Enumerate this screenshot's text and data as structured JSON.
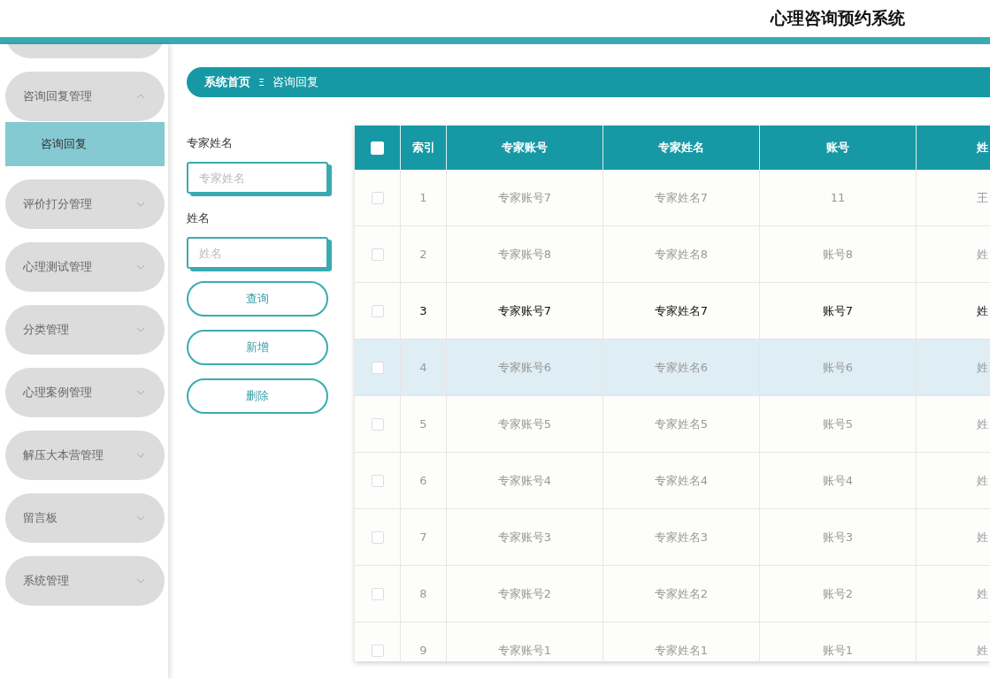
{
  "header": {
    "title": "心理咨询预约系统"
  },
  "sidebar": {
    "items": [
      {
        "label": "咨询回复管理",
        "expanded": true,
        "children": [
          {
            "label": "咨询回复",
            "selected": true
          }
        ]
      },
      {
        "label": "评价打分管理",
        "expanded": false
      },
      {
        "label": "心理测试管理",
        "expanded": false
      },
      {
        "label": "分类管理",
        "expanded": false
      },
      {
        "label": "心理案例管理",
        "expanded": false
      },
      {
        "label": "解压大本营管理",
        "expanded": false
      },
      {
        "label": "留言板",
        "expanded": false
      },
      {
        "label": "系统管理",
        "expanded": false
      }
    ]
  },
  "breadcrumb": {
    "home": "系统首页",
    "separator": "Ξ",
    "current": "咨询回复"
  },
  "search": {
    "fields": [
      {
        "label": "专家姓名",
        "placeholder": "专家姓名"
      },
      {
        "label": "姓名",
        "placeholder": "姓名"
      }
    ],
    "buttons": [
      "查询",
      "新增",
      "删除"
    ]
  },
  "table": {
    "header_checked": false,
    "columns": [
      "索引",
      "专家账号",
      "专家姓名",
      "账号",
      "姓"
    ],
    "rows": [
      {
        "checked": false,
        "emphasized": false,
        "hovered": false,
        "cells": [
          "1",
          "专家账号7",
          "专家姓名7",
          "11",
          "王"
        ]
      },
      {
        "checked": false,
        "emphasized": false,
        "hovered": false,
        "cells": [
          "2",
          "专家账号8",
          "专家姓名8",
          "账号8",
          "姓"
        ]
      },
      {
        "checked": false,
        "emphasized": true,
        "hovered": false,
        "cells": [
          "3",
          "专家账号7",
          "专家姓名7",
          "账号7",
          "姓"
        ]
      },
      {
        "checked": false,
        "emphasized": false,
        "hovered": true,
        "cells": [
          "4",
          "专家账号6",
          "专家姓名6",
          "账号6",
          "姓"
        ]
      },
      {
        "checked": false,
        "emphasized": false,
        "hovered": false,
        "cells": [
          "5",
          "专家账号5",
          "专家姓名5",
          "账号5",
          "姓"
        ]
      },
      {
        "checked": false,
        "emphasized": false,
        "hovered": false,
        "cells": [
          "6",
          "专家账号4",
          "专家姓名4",
          "账号4",
          "姓"
        ]
      },
      {
        "checked": false,
        "emphasized": false,
        "hovered": false,
        "cells": [
          "7",
          "专家账号3",
          "专家姓名3",
          "账号3",
          "姓"
        ]
      },
      {
        "checked": false,
        "emphasized": false,
        "hovered": false,
        "cells": [
          "8",
          "专家账号2",
          "专家姓名2",
          "账号2",
          "姓"
        ]
      },
      {
        "checked": false,
        "emphasized": false,
        "hovered": false,
        "cells": [
          "9",
          "专家账号1",
          "专家姓名1",
          "账号1",
          "姓"
        ]
      }
    ]
  }
}
